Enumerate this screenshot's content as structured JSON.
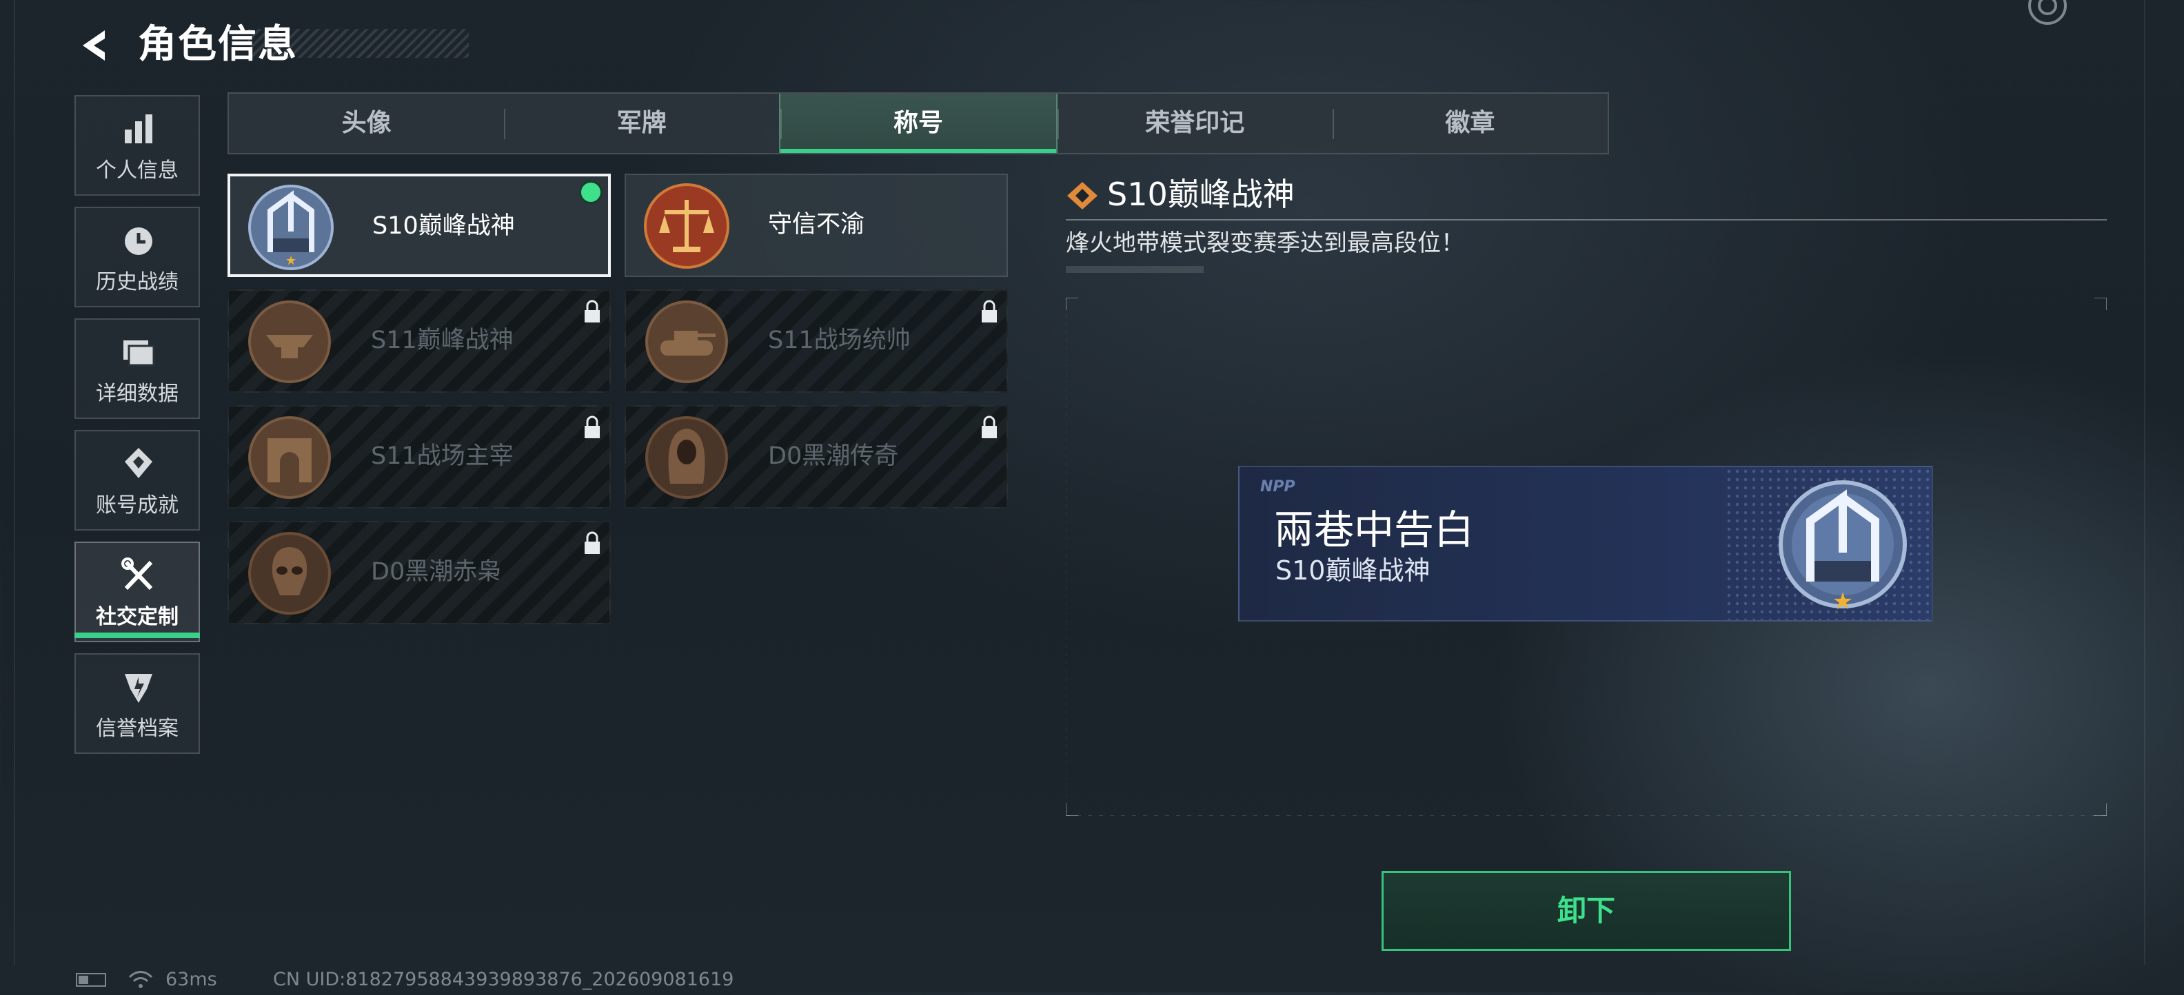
{
  "header": {
    "title": "角色信息",
    "back_icon": "back-arrow-icon"
  },
  "sidebar": {
    "items": [
      {
        "label": "个人信息",
        "icon": "bar-chart-icon",
        "active": false
      },
      {
        "label": "历史战绩",
        "icon": "history-clock-icon",
        "active": false
      },
      {
        "label": "详细数据",
        "icon": "folder-icon",
        "active": false
      },
      {
        "label": "账号成就",
        "icon": "achievement-icon",
        "active": false
      },
      {
        "label": "社交定制",
        "icon": "tools-icon",
        "active": true
      },
      {
        "label": "信誉档案",
        "icon": "shield-badge-icon",
        "active": false
      }
    ]
  },
  "tabs": [
    {
      "label": "头像",
      "active": false
    },
    {
      "label": "军牌",
      "active": false
    },
    {
      "label": "称号",
      "active": true
    },
    {
      "label": "荣誉印记",
      "active": false
    },
    {
      "label": "徽章",
      "active": false
    }
  ],
  "titles": [
    {
      "name": "S10巅峰战神",
      "locked": false,
      "selected": true,
      "equipped": true,
      "emblem": "peak-god-emblem-icon"
    },
    {
      "name": "守信不渝",
      "locked": false,
      "selected": false,
      "equipped": false,
      "emblem": "scales-emblem-icon"
    },
    {
      "name": "S11巅峰战神",
      "locked": true,
      "selected": false,
      "equipped": false,
      "emblem": "anvil-emblem-icon"
    },
    {
      "name": "S11战场统帅",
      "locked": true,
      "selected": false,
      "equipped": false,
      "emblem": "tank-emblem-icon"
    },
    {
      "name": "S11战场主宰",
      "locked": true,
      "selected": false,
      "equipped": false,
      "emblem": "arch-emblem-icon"
    },
    {
      "name": "D0黑潮传奇",
      "locked": true,
      "selected": false,
      "equipped": false,
      "emblem": "hooded-figure-emblem-icon"
    },
    {
      "name": "D0黑潮赤枭",
      "locked": true,
      "selected": false,
      "equipped": false,
      "emblem": "skull-emblem-icon"
    }
  ],
  "detail": {
    "title": "S10巅峰战神",
    "description": "烽火地带模式裂变赛季达到最高段位！",
    "banner": {
      "logo_text": "NPP",
      "player_name": "兩巷中告白",
      "title": "S10巅峰战神"
    },
    "action_label": "卸下"
  },
  "status_bar": {
    "ping": "63ms",
    "uid": "CN UID:818279588439398938​76_202609081619"
  },
  "colors": {
    "accent_green": "#38d08a",
    "banner_blue": "#233156",
    "star_gold": "#f2b230"
  }
}
